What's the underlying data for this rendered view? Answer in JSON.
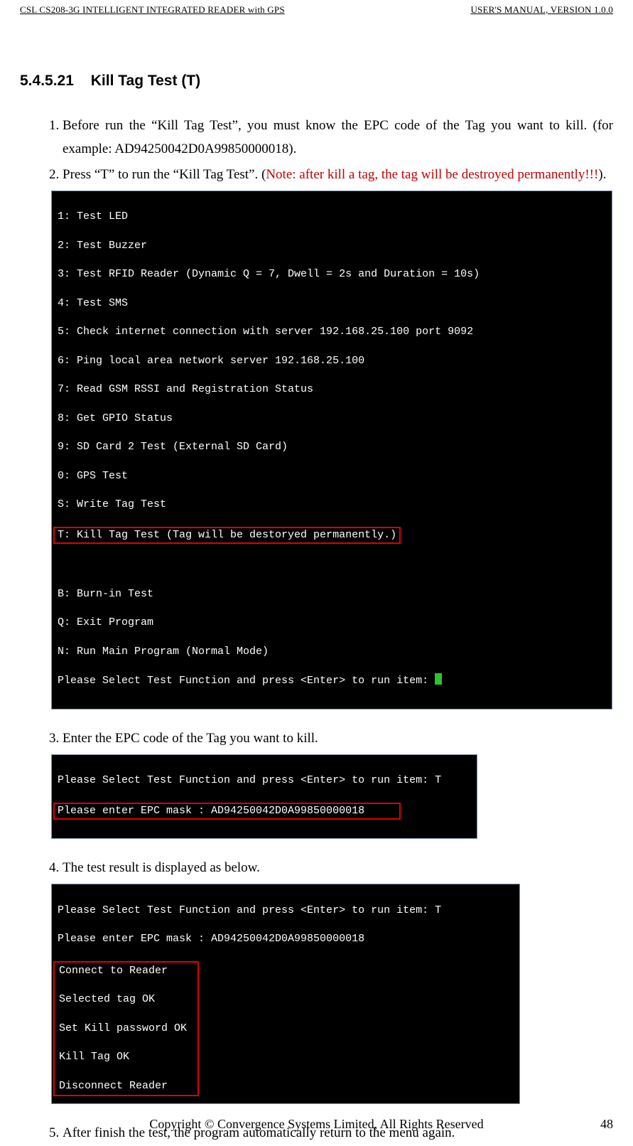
{
  "header": {
    "left": "CSL CS208-3G INTELLIGENT INTEGRATED READER with GPS",
    "right": "USER'S  MANUAL,  VERSION  1.0.0"
  },
  "section": {
    "number": "5.4.5.21",
    "title": "Kill Tag Test (T)"
  },
  "steps": {
    "s1a": "Before run the “Kill Tag Test”, you must know the EPC code of the Tag you want to kill. (for example: AD94250042D0A99850000018).",
    "s2a": "Press “T” to run the “Kill Tag Test”. (",
    "s2note": "Note: after kill a tag, the tag will be destroyed permanently!!!",
    "s2b": ").",
    "s3": "Enter the EPC code of the Tag you want to kill.",
    "s4": "The test result is displayed as below.",
    "s5": "After finish the test, the program automatically return to the menu again."
  },
  "term1": {
    "l1": "1: Test LED",
    "l2": "2: Test Buzzer",
    "l3": "3: Test RFID Reader (Dynamic Q = 7, Dwell = 2s and Duration = 10s)",
    "l4": "4: Test SMS",
    "l5": "5: Check internet connection with server 192.168.25.100 port 9092",
    "l6": "6: Ping local area network server 192.168.25.100",
    "l7": "7: Read GSM RSSI and Registration Status",
    "l8": "8: Get GPIO Status",
    "l9": "9: SD Card 2 Test (External SD Card)",
    "l10": "0: GPS Test",
    "l11": "S: Write Tag Test",
    "l12": "T: Kill Tag Test (Tag will be destoryed permanently.)",
    "l13": " ",
    "l14": "B: Burn-in Test",
    "l15": "Q: Exit Program",
    "l16": "N: Run Main Program (Normal Mode)",
    "l17": "Please Select Test Function and press <Enter> to run item: "
  },
  "term2": {
    "l1": "Please Select Test Function and press <Enter> to run item: T",
    "l2": "Please enter EPC mask : AD94250042D0A99850000018"
  },
  "term3": {
    "l1": "Please Select Test Function and press <Enter> to run item: T",
    "l2": "Please enter EPC mask : AD94250042D0A99850000018",
    "l3": "Connect to Reader",
    "l4": "Selected tag OK",
    "l5": "Set Kill password OK",
    "l6": "Kill Tag OK",
    "l7": "Disconnect Reader"
  },
  "footer": {
    "center": "Copyright © Convergence Systems Limited, All Rights Reserved",
    "page": "48"
  }
}
